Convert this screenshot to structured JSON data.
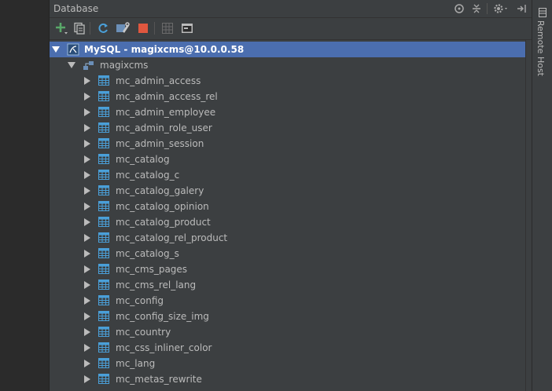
{
  "panel": {
    "title": "Database",
    "header_icons": [
      "crosshair-icon",
      "collapse-icon",
      "gear-icon",
      "hide-icon"
    ]
  },
  "toolbar": {
    "buttons": [
      "add-icon",
      "properties-icon",
      "refresh-icon",
      "settings-icon",
      "stop-icon",
      "table-view-icon",
      "console-icon"
    ]
  },
  "tree": {
    "connection": "MySQL - magixcms@10.0.0.58",
    "schema": "magixcms",
    "tables": [
      "mc_admin_access",
      "mc_admin_access_rel",
      "mc_admin_employee",
      "mc_admin_role_user",
      "mc_admin_session",
      "mc_catalog",
      "mc_catalog_c",
      "mc_catalog_galery",
      "mc_catalog_opinion",
      "mc_catalog_product",
      "mc_catalog_rel_product",
      "mc_catalog_s",
      "mc_cms_pages",
      "mc_cms_rel_lang",
      "mc_config",
      "mc_config_size_img",
      "mc_country",
      "mc_css_inliner_color",
      "mc_lang",
      "mc_metas_rewrite"
    ]
  },
  "side_tab": {
    "label": "Remote Host"
  },
  "colors": {
    "panel_bg": "#3c3f41",
    "selection": "#4b6eaf",
    "text": "#bbbbbb",
    "table_icon": "#4a9fd8"
  }
}
